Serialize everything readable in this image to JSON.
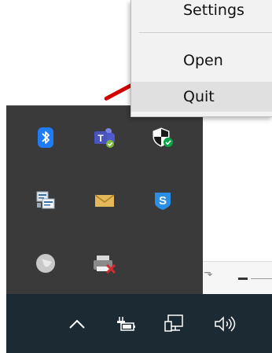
{
  "context_menu": {
    "items": [
      {
        "label": "Settings",
        "icon": "none"
      },
      {
        "label": "Open",
        "icon": "none"
      },
      {
        "label": "Quit",
        "icon": "none"
      }
    ],
    "highlighted": "Quit"
  },
  "tray_overflow": {
    "icons": [
      {
        "name": "bluetooth-icon",
        "color": "#1f7cf5"
      },
      {
        "name": "teams-icon",
        "color": "#6264a7"
      },
      {
        "name": "security-shield-icon",
        "color": "#0aa54a"
      },
      {
        "name": "network-adapter-icon",
        "color": "#dfe8ef"
      },
      {
        "name": "mail-envelope-icon",
        "color": "#e3b95c"
      },
      {
        "name": "s-shield-icon",
        "color": "#2a8fe6"
      },
      {
        "name": "globe-icon",
        "color": "#c8c8c8"
      },
      {
        "name": "printer-error-icon",
        "color": "#d42c2c"
      }
    ]
  },
  "taskbar": {
    "icons": [
      "chevron-up-icon",
      "battery-icon",
      "network-icon",
      "volume-icon"
    ]
  },
  "colors": {
    "menu_bg": "#f2f2f2",
    "menu_hover": "#e0e0e0",
    "tray_bg": "#3a3a3a",
    "taskbar_bg": "#1c2a33",
    "annotation": "#d40000"
  }
}
